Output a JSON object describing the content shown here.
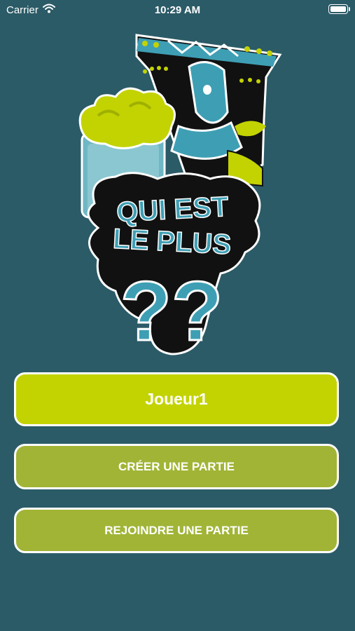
{
  "status_bar": {
    "carrier": "Carrier",
    "time": "10:29 AM"
  },
  "logo": {
    "line1": "QUI EST",
    "line2": "LE PLUS",
    "mark": "??"
  },
  "player": {
    "name": "Joueur1"
  },
  "actions": {
    "create_label": "CRÉER UNE PARTIE",
    "join_label": "REJOINDRE UNE PARTIE"
  },
  "colors": {
    "background": "#2b5b67",
    "player_button": "#c3d302",
    "action_button": "#a1b436",
    "logo_teal": "#3e9fb4",
    "logo_lime": "#c3d302"
  }
}
